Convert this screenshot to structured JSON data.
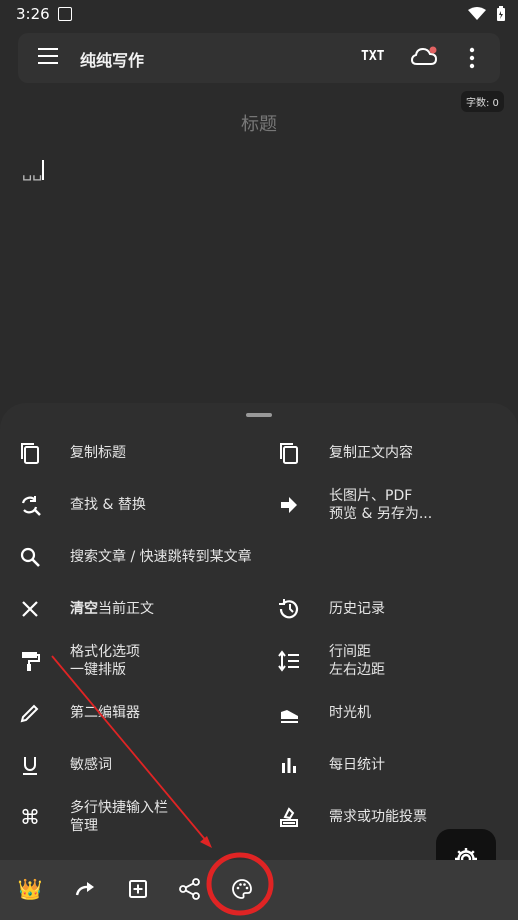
{
  "status": {
    "time": "3:26"
  },
  "app": {
    "title": "纯纯写作",
    "txt": "TXT"
  },
  "wordcount": "字数: 0",
  "doc": {
    "title_placeholder": "标题",
    "body": "␣␣"
  },
  "menu": {
    "left": [
      {
        "icon": "copy-icon",
        "lines": [
          "复制标题"
        ]
      },
      {
        "icon": "find-replace-icon",
        "lines": [
          "查找 & 替换"
        ]
      },
      {
        "icon": "search-icon",
        "lines": [
          "搜索文章 / 快速跳转到某文章"
        ]
      },
      {
        "icon": "close-icon",
        "lines": [
          "清空当前正文"
        ],
        "bold_prefix": "清空",
        "rest": "当前正文"
      },
      {
        "icon": "paint-roller-icon",
        "lines": [
          "格式化选项",
          "一键排版"
        ]
      },
      {
        "icon": "pencil-icon",
        "lines": [
          "第二编辑器"
        ]
      },
      {
        "icon": "underline-icon",
        "lines": [
          "敏感词"
        ]
      },
      {
        "icon": "command-icon",
        "lines": [
          "多行快捷输入栏",
          "管理"
        ]
      }
    ],
    "right": [
      {
        "icon": "copy-icon",
        "lines": [
          "复制正文内容"
        ]
      },
      {
        "icon": "arrow-right-icon",
        "lines": [
          "长图片、PDF",
          "预览 & 另存为..."
        ]
      },
      {
        "icon": "history-icon",
        "lines": [
          "历史记录"
        ]
      },
      {
        "icon": "line-spacing-icon",
        "lines": [
          "行间距",
          "左右边距"
        ]
      },
      {
        "icon": "time-machine-icon",
        "lines": [
          "时光机"
        ]
      },
      {
        "icon": "bar-chart-icon",
        "lines": [
          "每日统计"
        ]
      },
      {
        "icon": "vote-icon",
        "lines": [
          "需求或功能投票"
        ]
      }
    ]
  },
  "bottombar": [
    "crown-icon",
    "redo-icon",
    "add-box-icon",
    "share-icon",
    "palette-icon"
  ],
  "colors": {
    "accent_red": "#e02424",
    "bg": "#2b2b2b",
    "sheet": "#2f2f2f"
  }
}
